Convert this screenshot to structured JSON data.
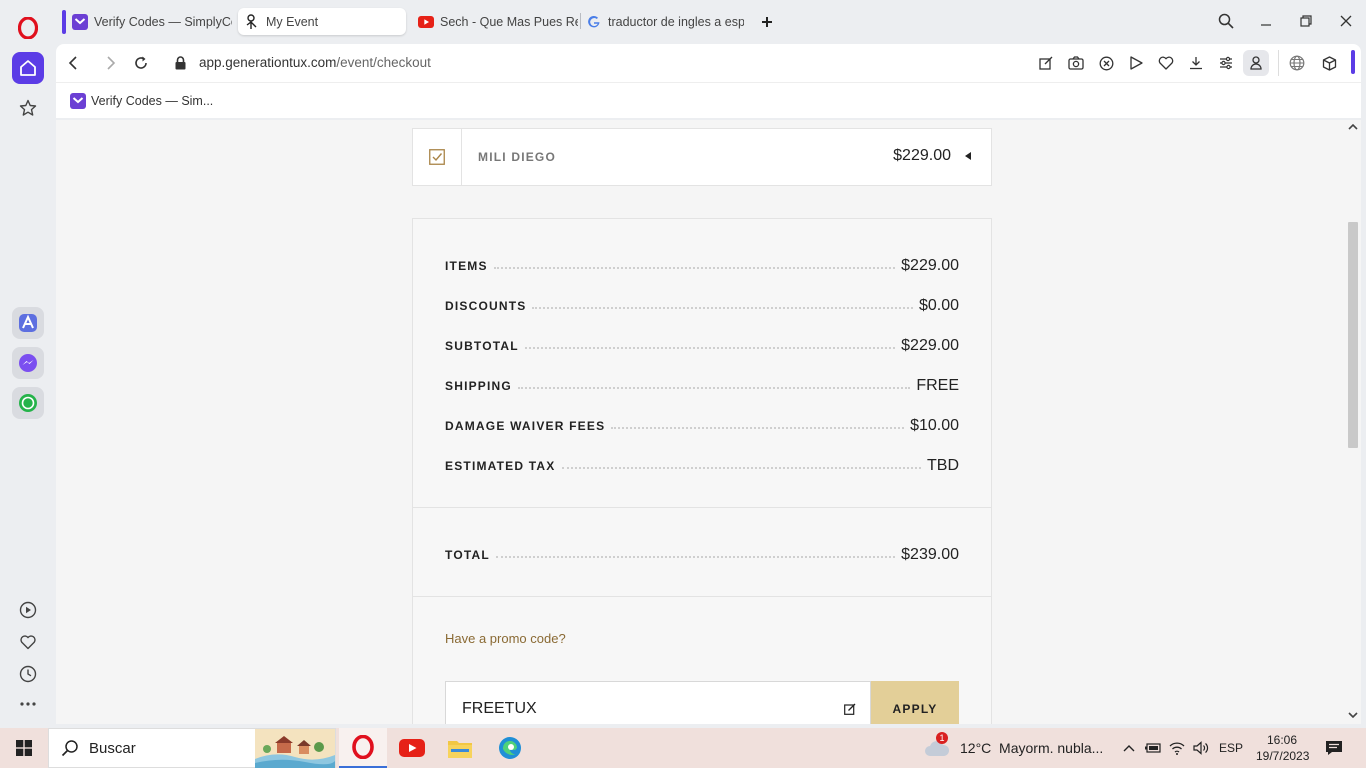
{
  "browser": {
    "tabs": [
      {
        "title": "Verify Codes — SimplyCodes",
        "favicon": "simplycodes-icon"
      },
      {
        "title": "My Event",
        "favicon": "generationtux-icon",
        "active": true
      },
      {
        "title": "Sech - Que Mas Pues Remix",
        "favicon": "youtube-icon"
      },
      {
        "title": "traductor de ingles a español",
        "favicon": "google-icon"
      }
    ],
    "url_host": "app.generationtux.com",
    "url_path": "/event/checkout",
    "bookmark": "Verify Codes — Sim..."
  },
  "checkout": {
    "item": {
      "name": "MILI DIEGO",
      "price": "$229.00",
      "checked": true
    },
    "summary": {
      "items_label": "ITEMS",
      "items_value": "$229.00",
      "discounts_label": "DISCOUNTS",
      "discounts_value": "$0.00",
      "subtotal_label": "SUBTOTAL",
      "subtotal_value": "$229.00",
      "shipping_label": "SHIPPING",
      "shipping_value": "FREE",
      "damage_label": "DAMAGE WAIVER FEES",
      "damage_value": "$10.00",
      "tax_label": "ESTIMATED TAX",
      "tax_value": "TBD",
      "total_label": "TOTAL",
      "total_value": "$239.00"
    },
    "promo": {
      "link": "Have a promo code?",
      "code_value": "FREETUX",
      "apply_label": "APPLY"
    }
  },
  "taskbar": {
    "search_placeholder": "Buscar",
    "weather": "12°C  Mayorm. nubla...",
    "weather_badge": "1",
    "language": "ESP",
    "time": "16:06",
    "date": "19/7/2023"
  },
  "colors": {
    "accent_gold": "#e3cf98",
    "promo_link": "#8a6a34",
    "opera_red": "#e0101e",
    "sidebar_active": "#5b3ce6"
  }
}
